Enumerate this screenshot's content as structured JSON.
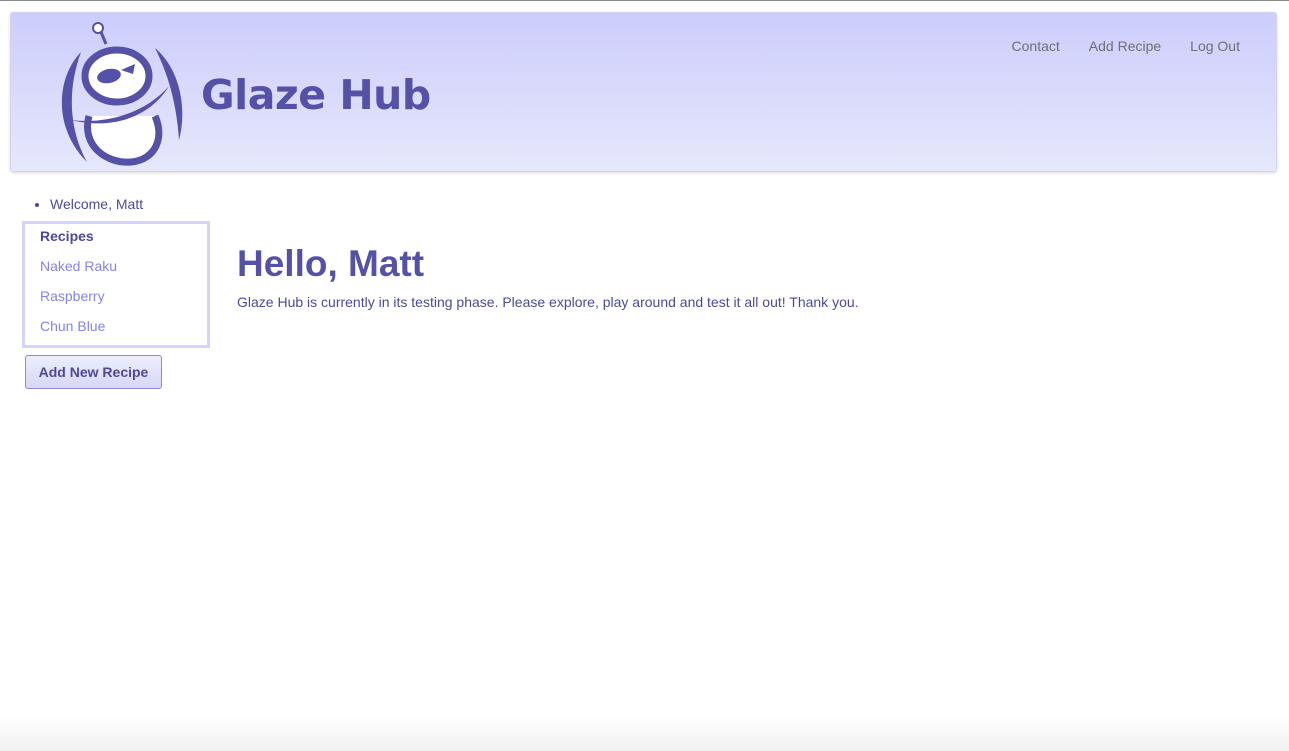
{
  "brand": {
    "name": "Glaze Hub",
    "logo_icon": "robot-mascot-icon"
  },
  "nav": {
    "items": [
      {
        "label": "Contact"
      },
      {
        "label": "Add Recipe"
      },
      {
        "label": "Log Out"
      }
    ]
  },
  "sidebar": {
    "welcome": "Welcome, Matt",
    "recipes_title": "Recipes",
    "recipes": [
      {
        "label": "Naked Raku"
      },
      {
        "label": "Raspberry"
      },
      {
        "label": "Chun Blue"
      }
    ],
    "add_button_label": "Add New Recipe"
  },
  "main": {
    "heading": "Hello, Matt",
    "message": "Glaze Hub is currently in its testing phase. Please explore, play around and test it all out! Thank you."
  },
  "colors": {
    "primary": "#5451a6",
    "link": "#8584e6",
    "header_bg": "#cccdfc",
    "box_border": "#d3d3fb"
  }
}
